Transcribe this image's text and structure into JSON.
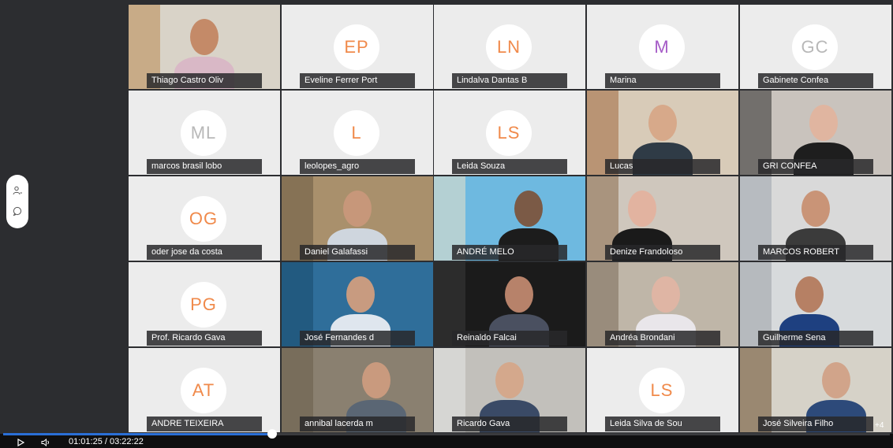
{
  "participants": [
    {
      "name": "Thiago Castro Oliv",
      "initials": "",
      "video": true
    },
    {
      "name": "Eveline Ferrer Port",
      "initials": "EP",
      "video": false,
      "color": "#f08a4b"
    },
    {
      "name": "Lindalva Dantas B",
      "initials": "LN",
      "video": false,
      "color": "#f08a4b"
    },
    {
      "name": "Marina",
      "initials": "M",
      "video": false,
      "color": "#a55bc7"
    },
    {
      "name": "Gabinete Confea",
      "initials": "GC",
      "video": false,
      "color": "#b8b8b8"
    },
    {
      "name": "marcos brasil lobo",
      "initials": "ML",
      "video": false,
      "color": "#b8b8b8"
    },
    {
      "name": "leolopes_agro",
      "initials": "L",
      "video": false,
      "color": "#f08a4b"
    },
    {
      "name": "Leida Souza",
      "initials": "LS",
      "video": false,
      "color": "#f08a4b"
    },
    {
      "name": "Lucas",
      "initials": "",
      "video": true
    },
    {
      "name": "GRI CONFEA",
      "initials": "",
      "video": true
    },
    {
      "name": "oder jose da costa",
      "initials": "OG",
      "video": false,
      "color": "#f08a4b"
    },
    {
      "name": "Daniel Galafassi",
      "initials": "",
      "video": true
    },
    {
      "name": "ANDRÉ MELO",
      "initials": "",
      "video": true
    },
    {
      "name": "Denize Frandoloso",
      "initials": "",
      "video": true
    },
    {
      "name": "MARCOS ROBERT",
      "initials": "",
      "video": true
    },
    {
      "name": "Prof. Ricardo Gava",
      "initials": "PG",
      "video": false,
      "color": "#f08a4b"
    },
    {
      "name": "José Fernandes d",
      "initials": "",
      "video": true
    },
    {
      "name": "Reinaldo Falcai",
      "initials": "",
      "video": true
    },
    {
      "name": "Andréa Brondani",
      "initials": "",
      "video": true
    },
    {
      "name": "Guilherme Sena",
      "initials": "",
      "video": true
    },
    {
      "name": "ANDRE TEIXEIRA",
      "initials": "AT",
      "video": false,
      "color": "#f08a4b"
    },
    {
      "name": "annibal lacerda m",
      "initials": "",
      "video": true
    },
    {
      "name": "Ricardo Gava",
      "initials": "",
      "video": true
    },
    {
      "name": "Leida Silva de Sou",
      "initials": "LS",
      "video": false,
      "color": "#f08a4b"
    },
    {
      "name": "José Silveira Filho",
      "initials": "",
      "video": true
    }
  ],
  "overflow_count": "+4",
  "player": {
    "time": "01:01:25 / 03:22:22",
    "progress": 0.303
  },
  "icons": {
    "play": "play-icon",
    "volume": "volume-icon",
    "participants": "participants-icon",
    "chat": "chat-icon"
  }
}
